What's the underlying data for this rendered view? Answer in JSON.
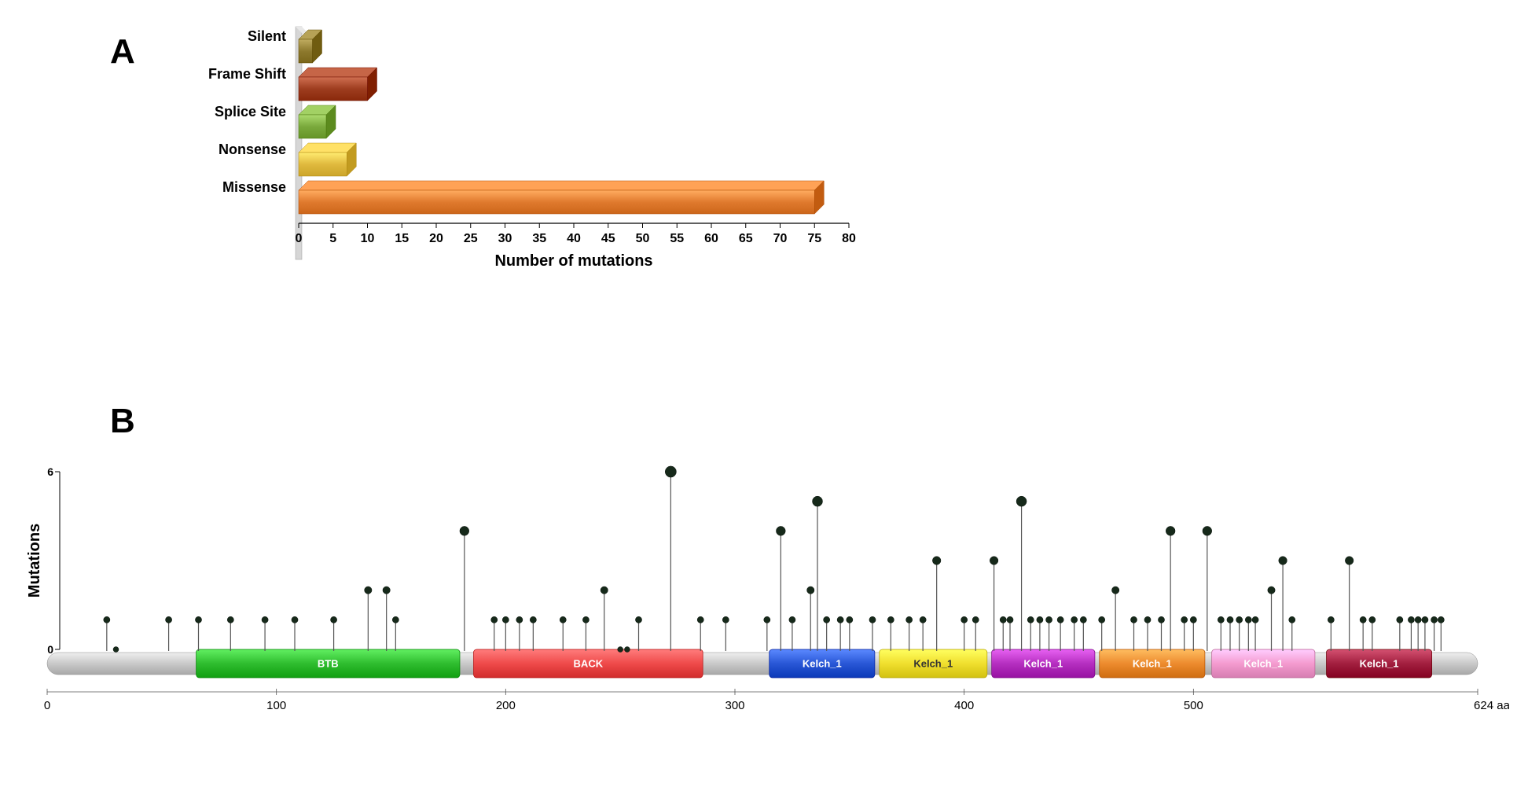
{
  "panels": {
    "A": "A",
    "B": "B"
  },
  "chart_data": [
    {
      "type": "bar",
      "title": "",
      "orientation": "horizontal",
      "xlabel": "Number of mutations",
      "ylabel": "",
      "xlim": [
        0,
        80
      ],
      "xticks": [
        0,
        5,
        10,
        15,
        20,
        25,
        30,
        35,
        40,
        45,
        50,
        55,
        60,
        65,
        70,
        75,
        80
      ],
      "categories": [
        "Silent",
        "Frame Shift",
        "Splice Site",
        "Nonsense",
        "Missense"
      ],
      "values": [
        2,
        10,
        4,
        7,
        75
      ],
      "colors": [
        "#8e7a2e",
        "#9e3d1f",
        "#7aa93c",
        "#e0b93e",
        "#e07a2e"
      ]
    },
    {
      "type": "lollipop",
      "title": "",
      "xlabel": "",
      "ylabel": "Mutations",
      "xlim": [
        0,
        624
      ],
      "ylim": [
        0,
        6
      ],
      "xticks": [
        0,
        100,
        200,
        300,
        400,
        500,
        "624 aa"
      ],
      "yticks": [
        0,
        6
      ],
      "domains": [
        {
          "name": "BTB",
          "start": 65,
          "end": 180,
          "color": "#2fbd2f",
          "text_color": "#ffffff"
        },
        {
          "name": "BACK",
          "start": 186,
          "end": 286,
          "color": "#ef4a4a",
          "text_color": "#ffffff"
        },
        {
          "name": "Kelch_1",
          "start": 315,
          "end": 361,
          "color": "#2957d6",
          "text_color": "#ffffff"
        },
        {
          "name": "Kelch_1",
          "start": 363,
          "end": 410,
          "color": "#f0df2e",
          "text_color": "#5a4600"
        },
        {
          "name": "Kelch_1",
          "start": 412,
          "end": 457,
          "color": "#b52fc0",
          "text_color": "#ffffff"
        },
        {
          "name": "Kelch_1",
          "start": 459,
          "end": 505,
          "color": "#ed8b2e",
          "text_color": "#ffffff"
        },
        {
          "name": "Kelch_1",
          "start": 508,
          "end": 553,
          "color": "#f49bcf",
          "text_color": "#ffffff"
        },
        {
          "name": "Kelch_1",
          "start": 558,
          "end": 604,
          "color": "#a21f3f",
          "text_color": "#ffffff"
        }
      ],
      "lollipops": [
        {
          "pos": 26,
          "count": 1
        },
        {
          "pos": 30,
          "count": 0
        },
        {
          "pos": 53,
          "count": 1
        },
        {
          "pos": 66,
          "count": 1
        },
        {
          "pos": 80,
          "count": 1
        },
        {
          "pos": 95,
          "count": 1
        },
        {
          "pos": 108,
          "count": 1
        },
        {
          "pos": 125,
          "count": 1
        },
        {
          "pos": 140,
          "count": 2
        },
        {
          "pos": 148,
          "count": 2
        },
        {
          "pos": 152,
          "count": 1
        },
        {
          "pos": 182,
          "count": 4
        },
        {
          "pos": 195,
          "count": 1
        },
        {
          "pos": 200,
          "count": 1
        },
        {
          "pos": 206,
          "count": 1
        },
        {
          "pos": 212,
          "count": 1
        },
        {
          "pos": 225,
          "count": 1
        },
        {
          "pos": 235,
          "count": 1
        },
        {
          "pos": 243,
          "count": 2
        },
        {
          "pos": 250,
          "count": 0
        },
        {
          "pos": 253,
          "count": 0
        },
        {
          "pos": 258,
          "count": 1
        },
        {
          "pos": 272,
          "count": 6
        },
        {
          "pos": 285,
          "count": 1
        },
        {
          "pos": 296,
          "count": 1
        },
        {
          "pos": 314,
          "count": 1
        },
        {
          "pos": 320,
          "count": 4
        },
        {
          "pos": 325,
          "count": 1
        },
        {
          "pos": 333,
          "count": 2
        },
        {
          "pos": 336,
          "count": 5
        },
        {
          "pos": 340,
          "count": 1
        },
        {
          "pos": 346,
          "count": 1
        },
        {
          "pos": 350,
          "count": 1
        },
        {
          "pos": 360,
          "count": 1
        },
        {
          "pos": 368,
          "count": 1
        },
        {
          "pos": 376,
          "count": 1
        },
        {
          "pos": 382,
          "count": 1
        },
        {
          "pos": 388,
          "count": 3
        },
        {
          "pos": 400,
          "count": 1
        },
        {
          "pos": 405,
          "count": 1
        },
        {
          "pos": 413,
          "count": 3
        },
        {
          "pos": 417,
          "count": 1
        },
        {
          "pos": 420,
          "count": 1
        },
        {
          "pos": 425,
          "count": 5
        },
        {
          "pos": 429,
          "count": 1
        },
        {
          "pos": 433,
          "count": 1
        },
        {
          "pos": 437,
          "count": 1
        },
        {
          "pos": 442,
          "count": 1
        },
        {
          "pos": 448,
          "count": 1
        },
        {
          "pos": 452,
          "count": 1
        },
        {
          "pos": 460,
          "count": 1
        },
        {
          "pos": 466,
          "count": 2
        },
        {
          "pos": 474,
          "count": 1
        },
        {
          "pos": 480,
          "count": 1
        },
        {
          "pos": 486,
          "count": 1
        },
        {
          "pos": 490,
          "count": 4
        },
        {
          "pos": 496,
          "count": 1
        },
        {
          "pos": 500,
          "count": 1
        },
        {
          "pos": 506,
          "count": 4
        },
        {
          "pos": 512,
          "count": 1
        },
        {
          "pos": 516,
          "count": 1
        },
        {
          "pos": 520,
          "count": 1
        },
        {
          "pos": 524,
          "count": 1
        },
        {
          "pos": 527,
          "count": 1
        },
        {
          "pos": 534,
          "count": 2
        },
        {
          "pos": 539,
          "count": 3
        },
        {
          "pos": 543,
          "count": 1
        },
        {
          "pos": 560,
          "count": 1
        },
        {
          "pos": 568,
          "count": 3
        },
        {
          "pos": 574,
          "count": 1
        },
        {
          "pos": 578,
          "count": 1
        },
        {
          "pos": 590,
          "count": 1
        },
        {
          "pos": 595,
          "count": 1
        },
        {
          "pos": 598,
          "count": 1
        },
        {
          "pos": 601,
          "count": 1
        },
        {
          "pos": 605,
          "count": 1
        },
        {
          "pos": 608,
          "count": 1
        }
      ]
    }
  ]
}
